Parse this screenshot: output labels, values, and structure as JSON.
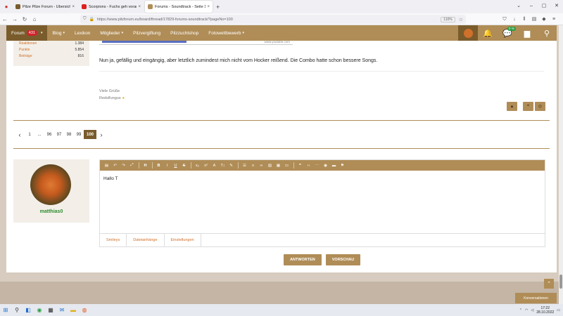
{
  "browser": {
    "tabs": [
      {
        "title": "Pilze Pilze Forum - Übersicht der",
        "color": "#7a5c2c"
      },
      {
        "title": "Scorpions - Fuchs geh voran - AKBWARR",
        "color": "#e02020"
      },
      {
        "title": "Forums - Soundtrack - Seite 100 -",
        "color": "#b08d57"
      }
    ],
    "url": "https://www.pilzforum.eu/board/thread/17829-forums-soundtrack/?pageNo=100",
    "zoom": "110%"
  },
  "nav": {
    "items": [
      {
        "label": "Forum",
        "badge": "431"
      },
      {
        "label": "Blog"
      },
      {
        "label": "Lexikon"
      },
      {
        "label": "Mitglieder"
      },
      {
        "label": "Pilzvergiftung"
      },
      {
        "label": "Pilzzuchtshop"
      },
      {
        "label": "Fotowettbewerb"
      }
    ],
    "messages_badge": "0 %"
  },
  "stats": [
    {
      "label": "Reaktionen",
      "value": "1.384"
    },
    {
      "label": "Punkte",
      "value": "5.854"
    },
    {
      "label": "Beiträge",
      "value": "816"
    }
  ],
  "video_source": "www.youtube.com",
  "post": {
    "text": "Nun ja, gefällig und eingängig, aber letztlich zumindest mich nicht vom Hocker reißend. Die Combo hatte schon bessere Songs.",
    "greeting": "Viele Grüße",
    "signature": "Redslfungus"
  },
  "pagination": {
    "pages": [
      "1",
      "...",
      "96",
      "97",
      "98",
      "99",
      "100"
    ],
    "current": "100"
  },
  "user": {
    "name": "matthias0"
  },
  "editor": {
    "toolbar": [
      "doc-icon",
      "undo-icon",
      "redo-icon",
      "fullscreen-icon",
      "H",
      "B",
      "I",
      "U",
      "S",
      "x₂",
      "x²",
      "A",
      "T↕",
      "brush-icon",
      "list-icon",
      "align-icon",
      "link-icon",
      "image-icon",
      "table-icon",
      "media-icon",
      "quote-icon",
      "code-icon",
      "dots-icon",
      "eye-icon",
      "screen-icon",
      "flag-icon"
    ],
    "text": "Hallo T",
    "tabs": [
      "Smileys",
      "Dateianhänge",
      "Einstellungen"
    ]
  },
  "actions": {
    "submit": "ANTWORTEN",
    "preview": "VORSCHAU"
  },
  "conversations": "Konversationen",
  "taskbar": {
    "time": "17:22",
    "date": "28.10.2022"
  },
  "colors": {
    "brand": "#b08d57",
    "brand_dark": "#7a5c2c",
    "accent": "#d0702a",
    "username": "#2e8b2e"
  }
}
